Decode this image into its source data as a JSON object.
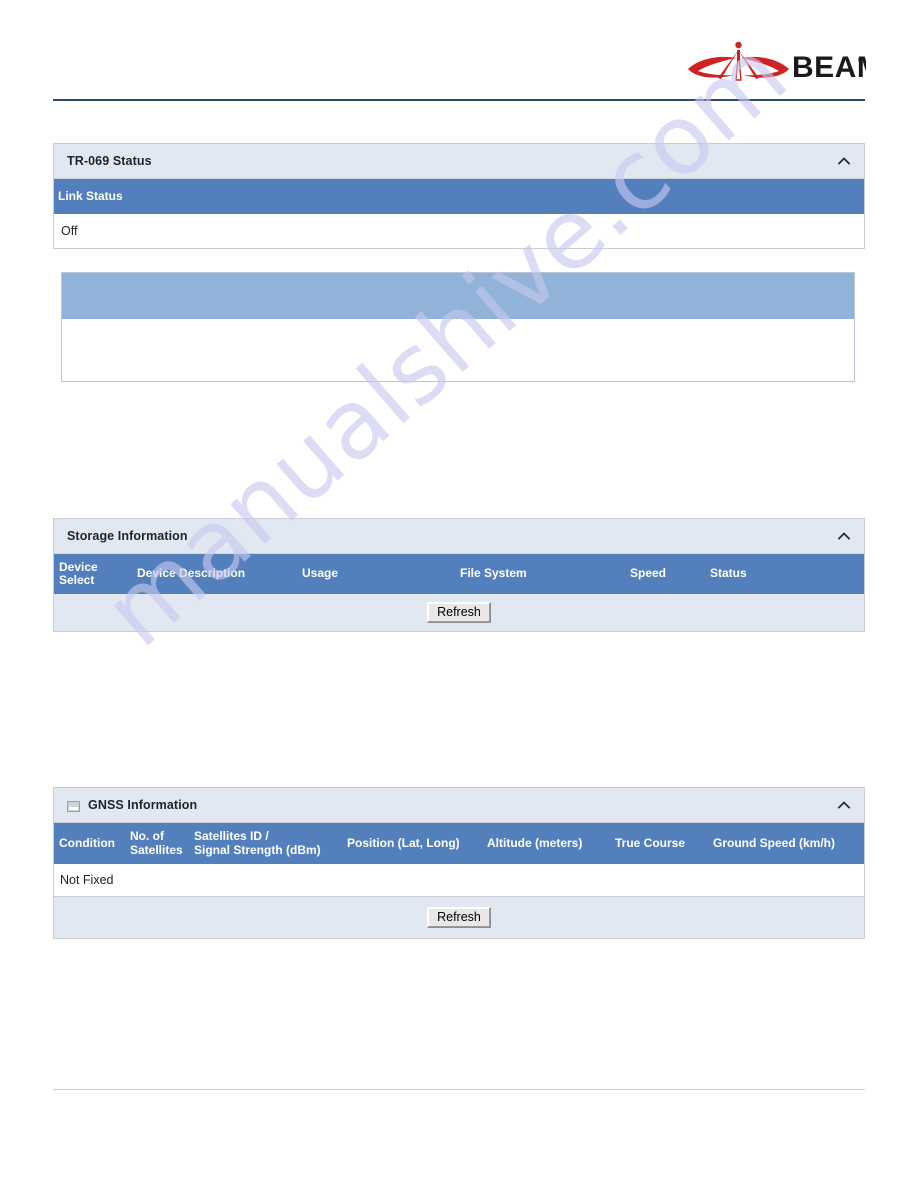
{
  "brand": {
    "name": "BEAM",
    "trademark": "®",
    "logo_icon": "beam-antenna-logo",
    "logo_color": "#cf2222",
    "wordmark_color": "#1a1a1a"
  },
  "watermark": {
    "text": "manualshive.com"
  },
  "colors": {
    "header_bar": "#5380bd",
    "header_bar_light": "#91b2d9",
    "panel_title_bg": "#e2e8f2",
    "rule_dark": "#2e4a6b",
    "rule_light": "#d2d2d2"
  },
  "panels": {
    "tr069": {
      "title": "TR-069 Status",
      "collapse_icon": "chevron-up-icon",
      "columns": [
        "Link Status"
      ],
      "rows": [
        [
          "Off"
        ]
      ]
    },
    "blank": {
      "title": "",
      "columns": [
        ""
      ],
      "rows": [
        [
          ""
        ]
      ]
    },
    "storage": {
      "title": "Storage Information",
      "collapse_icon": "chevron-up-icon",
      "columns": [
        "Device\nSelect",
        "Device Description",
        "Usage",
        "File System",
        "Speed",
        "Status"
      ],
      "rows": [],
      "refresh_label": "Refresh"
    },
    "gnss": {
      "title": "GNSS Information",
      "title_icon": "broken-image-icon",
      "collapse_icon": "chevron-up-icon",
      "columns": [
        "Condition",
        "No. of\nSatellites",
        "Satellites ID /\nSignal Strength (dBm)",
        "Position (Lat, Long)",
        "Altitude (meters)",
        "True Course",
        "Ground Speed (km/h)"
      ],
      "rows": [
        [
          "Not Fixed"
        ]
      ],
      "refresh_label": "Refresh"
    }
  }
}
